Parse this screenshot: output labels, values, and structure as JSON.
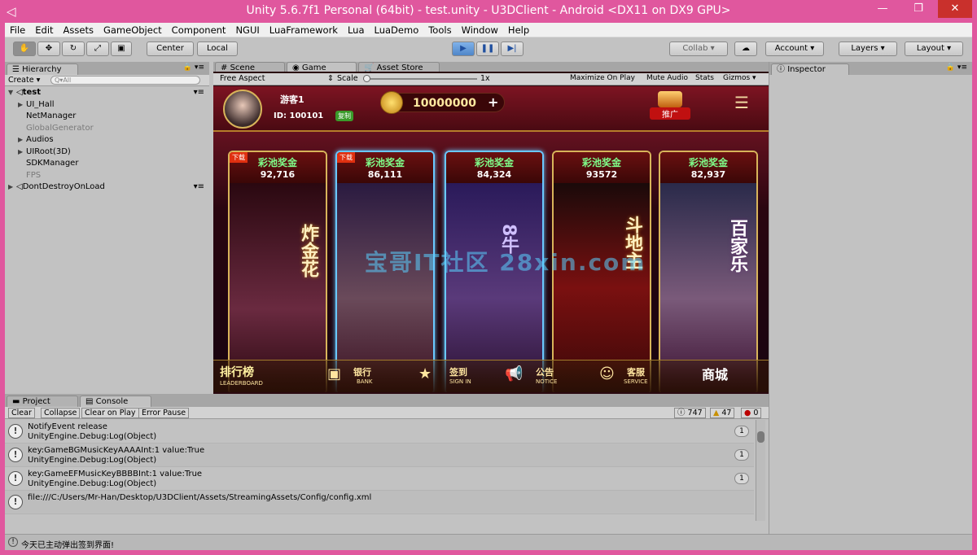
{
  "window": {
    "title": "Unity 5.6.7f1 Personal (64bit) - test.unity - U3DClient - Android <DX11 on DX9 GPU>"
  },
  "menu": [
    "File",
    "Edit",
    "Assets",
    "GameObject",
    "Component",
    "NGUI",
    "LuaFramework",
    "Lua",
    "LuaDemo",
    "Tools",
    "Window",
    "Help"
  ],
  "toolbar": {
    "center_label": "Center",
    "local_label": "Local",
    "collab_label": "Collab",
    "account_label": "Account",
    "layers_label": "Layers",
    "layout_label": "Layout"
  },
  "hierarchy": {
    "tab": "Hierarchy",
    "create_label": "Create",
    "search_placeholder": "Q▾All",
    "scene": "test",
    "items": [
      "UI_Hall",
      "NetManager",
      "GlobalGenerator",
      "Audios",
      "UIRoot(3D)",
      "SDKManager",
      "FPS"
    ],
    "dontdestroy": "DontDestroyOnLoad"
  },
  "tabs": {
    "scene": "Scene",
    "game": "Game",
    "asset_store": "Asset Store",
    "inspector": "Inspector",
    "project": "Project",
    "console": "Console"
  },
  "gamebar": {
    "aspect": "Free Aspect",
    "scale_label": "Scale",
    "scale_value": "1x",
    "maximize": "Maximize On Play",
    "mute": "Mute Audio",
    "stats": "Stats",
    "gizmos": "Gizmos"
  },
  "game": {
    "player_name": "游客1",
    "player_id": "ID: 100101",
    "copy_label": "复制",
    "coins": "10000000",
    "plus": "+",
    "promo_label": "推广",
    "download_tag": "下载",
    "cards": [
      {
        "title": "彩池奖金",
        "value": "92,716",
        "art": "炸金花"
      },
      {
        "title": "彩池奖金",
        "value": "86,111",
        "art": ""
      },
      {
        "title": "彩池奖金",
        "value": "84,324",
        "art": "8牛"
      },
      {
        "title": "彩池奖金",
        "value": "93572",
        "art": "斗地主"
      },
      {
        "title": "彩池奖金",
        "value": "82,937",
        "art": "百家乐"
      }
    ],
    "dock": [
      {
        "label": "排行榜",
        "sub": "LEADERBOARD"
      },
      {
        "label": "银行",
        "sub": "BANK"
      },
      {
        "label": "签到",
        "sub": "SIGN IN"
      },
      {
        "label": "公告",
        "sub": "NOTICE"
      },
      {
        "label": "客服",
        "sub": "SERVICE"
      },
      {
        "label": "商城",
        "sub": ""
      }
    ],
    "watermark": "宝哥IT社区 28xin.com"
  },
  "console": {
    "buttons": [
      "Clear",
      "Collapse",
      "Clear on Play",
      "Error Pause"
    ],
    "count_info": "747",
    "count_warn": "47",
    "count_error": "0",
    "logs": [
      {
        "line1": "NotifyEvent release",
        "line2": "UnityEngine.Debug:Log(Object)",
        "count": "1"
      },
      {
        "line1": "key:GameBGMusicKeyAAAAInt:1  value:True",
        "line2": "UnityEngine.Debug:Log(Object)",
        "count": "1"
      },
      {
        "line1": "key:GameEFMusicKeyBBBBInt:1  value:True",
        "line2": "UnityEngine.Debug:Log(Object)",
        "count": "1"
      },
      {
        "line1": "file:///C:/Users/Mr-Han/Desktop/U3DClient/Assets/StreamingAssets/Config/config.xml",
        "line2": "",
        "count": ""
      }
    ]
  },
  "status": {
    "message": "今天已主动弹出签到界面!"
  }
}
